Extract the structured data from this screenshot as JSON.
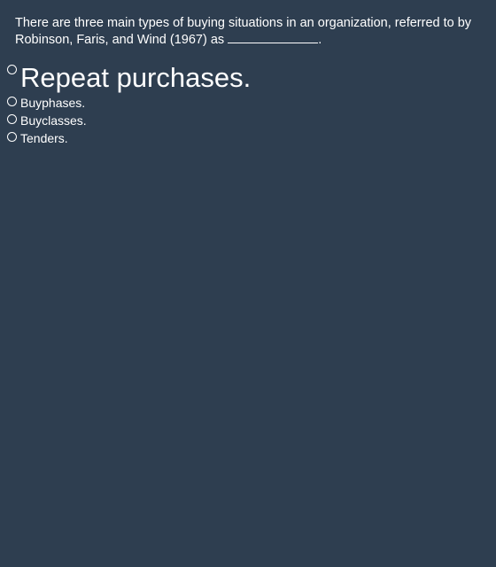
{
  "question": {
    "text": "There are three main types of buying situations in an organization, referred to by Robinson, Faris, and Wind (1967) as",
    "end_punct": "."
  },
  "options": [
    {
      "label": "Repeat purchases."
    },
    {
      "label": "Buyphases."
    },
    {
      "label": "Buyclasses."
    },
    {
      "label": "Tenders."
    }
  ]
}
